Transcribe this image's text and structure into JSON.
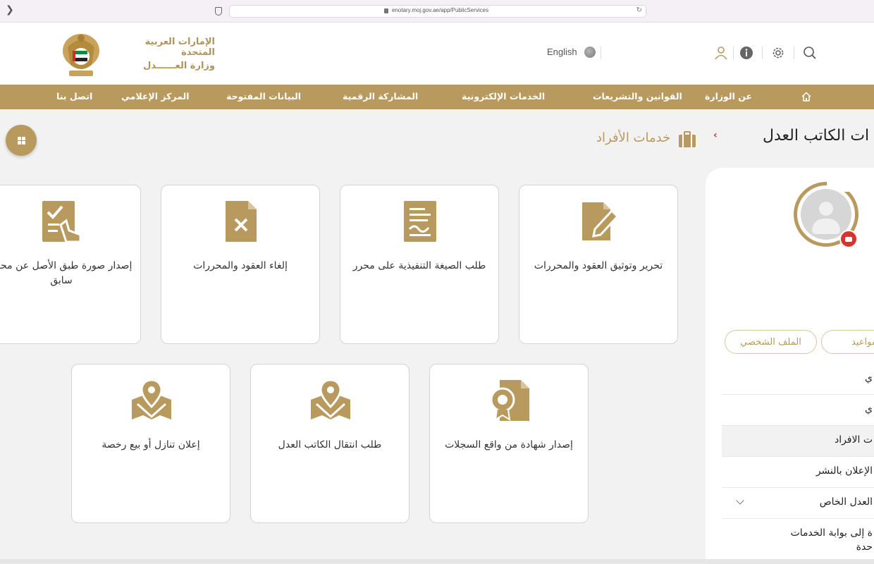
{
  "browser": {
    "url": "enotary.moj.gov.ae/app/PublicServices"
  },
  "header": {
    "ministry_line1": "الإمارات العربية المتحدة",
    "ministry_line2": "وزارة العــــــدل",
    "language_label": "English"
  },
  "nav": {
    "items": [
      {
        "label": "عن الوزارة"
      },
      {
        "label": "القوانين والتشريعات"
      },
      {
        "label": "الخدمات الإلكترونية"
      },
      {
        "label": "المشاركة الرقمية"
      },
      {
        "label": "البيانات المفتوحة"
      },
      {
        "label": "المركز الإعلامي"
      },
      {
        "label": "اتصل بنا"
      }
    ]
  },
  "main": {
    "page_title": "ات الكاتب العدل",
    "section_title": "خدمات الأفراد",
    "cards": [
      {
        "label": "تحرير وتوثيق العقود والمحررات"
      },
      {
        "label": "طلب الصيغة التنفيذية على محرر"
      },
      {
        "label": "إلغاء العقود والمحررات"
      },
      {
        "label": "إصدار صورة طبق الأصل عن محرر سابق"
      },
      {
        "label": "إصدار شهادة من واقع السجلات"
      },
      {
        "label": "طلب انتقال الكاتب العدل"
      },
      {
        "label": "إعلان تنازل أو بيع رخصة"
      }
    ]
  },
  "sidebar": {
    "tabs": [
      {
        "label": "الملف الشخصي"
      },
      {
        "label": "المواعيد"
      }
    ],
    "menu": [
      {
        "label": "ي"
      },
      {
        "label": "ي"
      },
      {
        "label": "ت الافراد"
      },
      {
        "label": "الإعلان بالنشر"
      },
      {
        "label": "العدل الخاص"
      },
      {
        "label": "ة إلى بوابة الخدمات"
      },
      {
        "label": "حدة"
      }
    ]
  },
  "colors": {
    "gold": "#b8995e",
    "badge_red": "#d9342b"
  }
}
